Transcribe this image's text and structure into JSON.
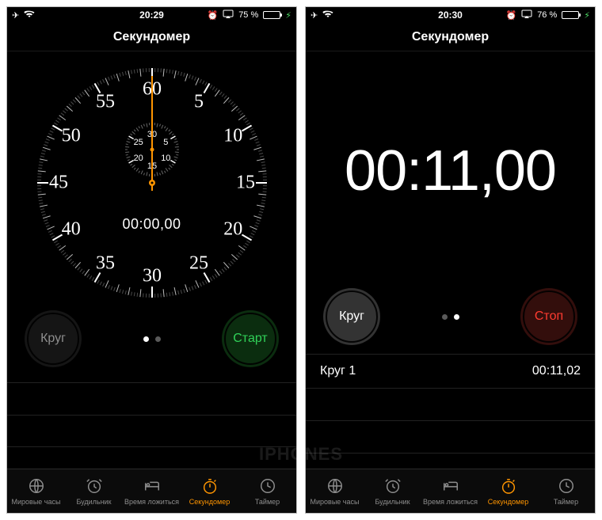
{
  "watermark": "IPHONES",
  "tabbar": {
    "items": [
      {
        "icon": "globe-icon",
        "label": "Мировые часы"
      },
      {
        "icon": "alarm-clock-icon",
        "label": "Будильник"
      },
      {
        "icon": "bed-icon",
        "label": "Время ложиться"
      },
      {
        "icon": "stopwatch-icon",
        "label": "Секундомер"
      },
      {
        "icon": "timer-icon",
        "label": "Таймер"
      }
    ],
    "active_index": 3
  },
  "left": {
    "status": {
      "time": "20:29",
      "battery_pct": "75 %",
      "battery_fill_pct": 75
    },
    "title": "Секундомер",
    "dial": {
      "major_numbers": [
        "60",
        "5",
        "10",
        "15",
        "20",
        "25",
        "30",
        "35",
        "40",
        "45",
        "50",
        "55"
      ],
      "sub_numbers": [
        "30",
        "5",
        "10",
        "15",
        "20",
        "25"
      ]
    },
    "digital": "00:00,00",
    "lap_label": "Круг",
    "action_label": "Старт",
    "page_dots_active": 0
  },
  "right": {
    "status": {
      "time": "20:30",
      "battery_pct": "76 %",
      "battery_fill_pct": 76
    },
    "title": "Секундомер",
    "big_time": "00:11,00",
    "lap_label": "Круг",
    "action_label": "Стоп",
    "page_dots_active": 1,
    "lap": {
      "name": "Круг 1",
      "value": "00:11,02"
    }
  },
  "colors": {
    "accent": "#ff9500",
    "start": "#30d158",
    "stop": "#ff3b30"
  }
}
